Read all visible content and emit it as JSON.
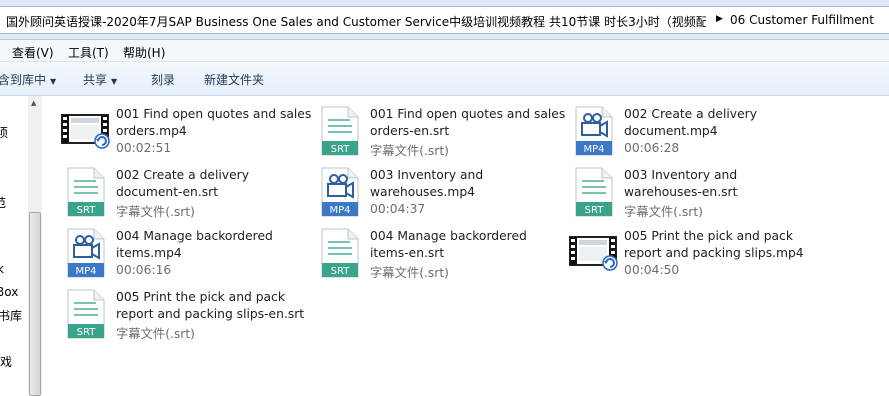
{
  "address": {
    "crumb_main": "国外顾问英语授课-2020年7月SAP Business One Sales and Customer Service中级培训视频教程 共10节课 时长3小时（视频配...",
    "crumb_sub": "06 Customer Fulfillment"
  },
  "menu": {
    "view": "查看(V)",
    "tools": "工具(T)",
    "help": "帮助(H)"
  },
  "toolbar": {
    "include_library": "包含到库中",
    "share": "共享",
    "burn": "刻录",
    "new_folder": "新建文件夹"
  },
  "nav_partial": [
    "须",
    "范",
    "k",
    "Box",
    "书库",
    "游戏"
  ],
  "files": [
    {
      "line1": "001 Find open quotes and sales",
      "line2": "orders.mp4",
      "meta": "00:02:51",
      "icon": "video-thumbnail-icon"
    },
    {
      "line1": "001 Find open quotes and sales",
      "line2": "orders-en.srt",
      "meta": "字幕文件(.srt)",
      "icon": "srt-file-icon",
      "badge": "SRT"
    },
    {
      "line1": "002 Create a delivery",
      "line2": "document.mp4",
      "meta": "00:06:28",
      "icon": "mp4-file-icon",
      "badge": "MP4"
    },
    {
      "line1": "002 Create a delivery",
      "line2": "document-en.srt",
      "meta": "字幕文件(.srt)",
      "icon": "srt-file-icon",
      "badge": "SRT"
    },
    {
      "line1": "003 Inventory and",
      "line2": "warehouses.mp4",
      "meta": "00:04:37",
      "icon": "mp4-file-icon",
      "badge": "MP4"
    },
    {
      "line1": "003 Inventory and",
      "line2": "warehouses-en.srt",
      "meta": "字幕文件(.srt)",
      "icon": "srt-file-icon",
      "badge": "SRT"
    },
    {
      "line1": "004 Manage backordered",
      "line2": "items.mp4",
      "meta": "00:06:16",
      "icon": "mp4-file-icon",
      "badge": "MP4"
    },
    {
      "line1": "004 Manage backordered",
      "line2": "items-en.srt",
      "meta": "字幕文件(.srt)",
      "icon": "srt-file-icon",
      "badge": "SRT"
    },
    {
      "line1": "005 Print the pick and pack",
      "line2": "report and packing slips.mp4",
      "meta": "00:04:50",
      "icon": "video-thumbnail-icon"
    },
    {
      "line1": "005 Print the pick and pack",
      "line2": "report and packing slips-en.srt",
      "meta": "字幕文件(.srt)",
      "icon": "srt-file-icon",
      "badge": "SRT"
    }
  ],
  "colors": {
    "srt_badge": "#3aa48a",
    "mp4_badge": "#3b78c7",
    "meta_text": "#6d6d6d",
    "toolbar_text": "#1e395b"
  }
}
